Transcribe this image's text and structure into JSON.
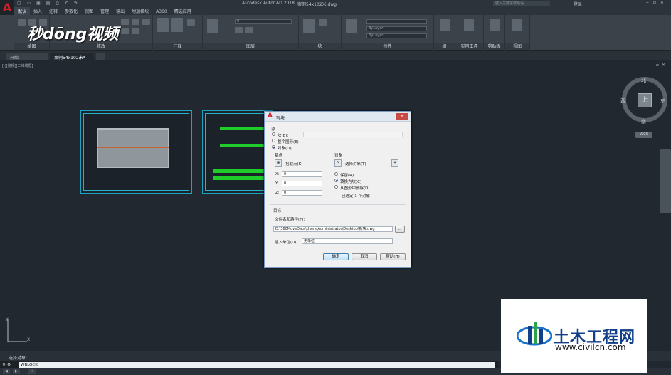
{
  "title": {
    "app": "Autodesk AutoCAD 2018",
    "file": "案例54x102米.dwg",
    "search_placeholder": "键入关键字或短语",
    "login": "登录"
  },
  "menu_tabs": [
    "默认",
    "插入",
    "注释",
    "参数化",
    "视图",
    "管理",
    "输出",
    "附加模块",
    "A360",
    "精选应用"
  ],
  "ribbon_groups": [
    "绘图",
    "修改",
    "注释",
    "图层",
    "块",
    "特性",
    "组",
    "实用工具",
    "剪贴板",
    "视图"
  ],
  "ribbon_layer_value": "0",
  "ribbon_bylayer": [
    "ByLayer",
    "ByLayer"
  ],
  "watermark": "秒dōng视频",
  "doc_tabs": [
    "开始",
    "案例54x102米*"
  ],
  "viewport_label": "[-][俯视][二维线框]",
  "viewcube": {
    "north": "北",
    "south": "南",
    "east": "东",
    "west": "西",
    "face": "上",
    "wcs": "WCS"
  },
  "dialog": {
    "title": "写块",
    "source_label": "源",
    "source_options": [
      {
        "label": "块(B):",
        "selected": false
      },
      {
        "label": "整个图形(E)",
        "selected": false
      },
      {
        "label": "对象(O)",
        "selected": true
      }
    ],
    "basepoint_label": "基点",
    "pick_point": "拾取点(K)",
    "coords": [
      {
        "axis": "X:",
        "value": "0"
      },
      {
        "axis": "Y:",
        "value": "0"
      },
      {
        "axis": "Z:",
        "value": "0"
      }
    ],
    "objects_label": "对象",
    "select_objects": "选择对象(T)",
    "object_options": [
      {
        "label": "保留(R)",
        "selected": false
      },
      {
        "label": "转换为块(C)",
        "selected": true
      },
      {
        "label": "从图形中删除(D)",
        "selected": false
      }
    ],
    "selected_count": "已选定 1 个对象",
    "target_label": "目标",
    "filename_label": "文件名和路径(F):",
    "filename_value": "D:\\360MoveData\\Users\\Administrator\\Desktop\\新块.dwg",
    "browse": "...",
    "units_label": "插入单位(U):",
    "units_value": "无单位",
    "ok": "确定",
    "cancel": "取消",
    "help": "帮助(H)"
  },
  "command": {
    "history": "选择对象:",
    "current": "WBLOCK"
  },
  "site_logo": {
    "name": "土木工程网",
    "url": "www.civilcn.com"
  }
}
